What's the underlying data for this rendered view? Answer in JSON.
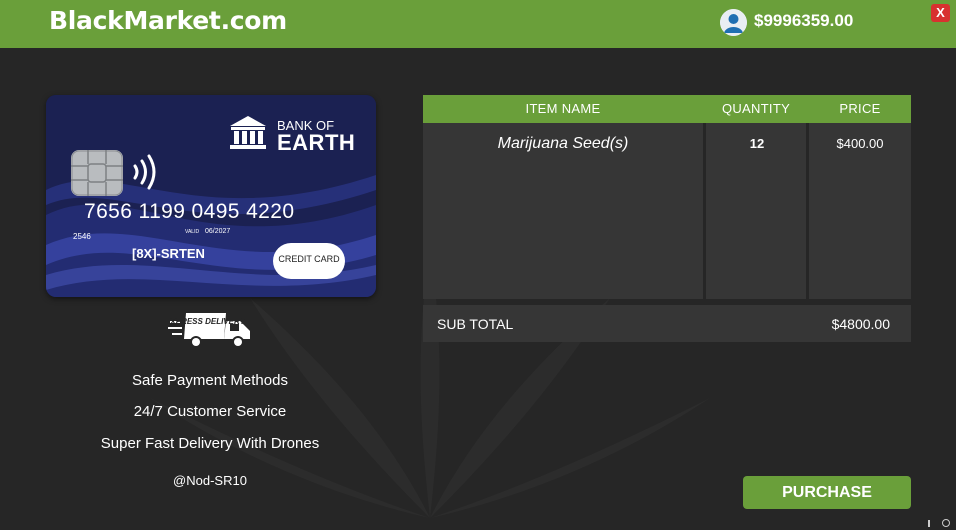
{
  "header": {
    "brand": "BlackMarket.com",
    "balance": "$9996359.00",
    "close_label": "X",
    "avatar_icon": "user-avatar-icon",
    "brand_color": "#6a9f3a"
  },
  "card": {
    "bank_line1": "BANK OF",
    "bank_line2": "EARTH",
    "number": "7656 1199 0495 4220",
    "small_code": "2546",
    "valid_label": "VALID",
    "valid_value": "06/2027",
    "holder": "[8X]-SRTEN",
    "type_label": "CREDIT CARD",
    "bank_icon": "bank-building-icon",
    "chip_icon": "chip-icon",
    "contactless_icon": "contactless-icon"
  },
  "features": {
    "delivery_icon": "express-delivery-truck-icon",
    "delivery_text": "EXPRESS DELIVERY",
    "items": [
      "Safe Payment Methods",
      "24/7 Customer Service",
      "Super Fast Delivery With Drones"
    ],
    "credit": "@Nod-SR10"
  },
  "cart": {
    "headers": [
      "ITEM NAME",
      "QUANTITY",
      "PRICE"
    ],
    "rows": [
      {
        "item": "Marijuana Seed(s)",
        "quantity": "12",
        "price": "$400.00"
      }
    ],
    "subtotal_label": "SUB TOTAL",
    "subtotal_value": "$4800.00"
  },
  "actions": {
    "purchase_label": "PURCHASE"
  }
}
